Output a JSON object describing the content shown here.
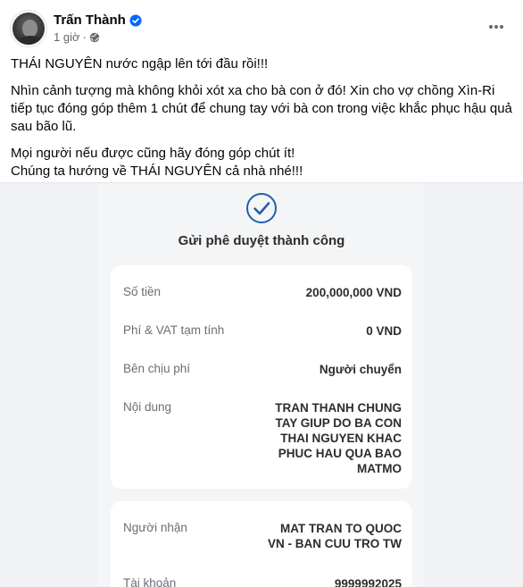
{
  "post": {
    "author": "Trấn Thành",
    "time": "1 giờ",
    "paragraphs": [
      "THÁI NGUYÊN nước ngập lên tới đầu rồi!!!",
      "Nhìn cảnh tượng mà không khỏi xót xa cho bà con ở đó! Xin cho vợ chồng Xìn-Ri tiếp tục đóng góp thêm 1 chút để chung tay với bà con trong việc khắc phục hậu quả sau bão lũ.",
      "Mọi người nếu được cũng hãy đóng góp chút ít!\nChúng ta hướng về THÁI NGUYÊN cả nhà nhé!!!"
    ]
  },
  "receipt": {
    "title": "Gửi phê duyệt thành công",
    "rows": [
      {
        "label": "Số tiền",
        "value": "200,000,000 VND"
      },
      {
        "label": "Phí & VAT tạm tính",
        "value": "0 VND"
      },
      {
        "label": "Bên chịu phí",
        "value": "Người chuyển"
      },
      {
        "label": "Nội dung",
        "value": "TRAN THANH CHUNG TAY GIUP DO BA CON THAI NGUYEN KHAC PHUC HAU QUA BAO MATMO"
      }
    ],
    "rows2": [
      {
        "label": "Người nhận",
        "value": "MAT TRAN TO QUOC VN - BAN CUU TRO TW"
      },
      {
        "label": "Tài khoản",
        "value": "9999992025"
      }
    ]
  },
  "colors": {
    "verified": "#0866ff",
    "check": "#1f5fae",
    "secondary_text": "#65676b"
  },
  "icons": {
    "verified": "verified-badge-icon",
    "privacy": "globe-icon",
    "more": "more-options-icon",
    "success": "check-circle-icon"
  }
}
